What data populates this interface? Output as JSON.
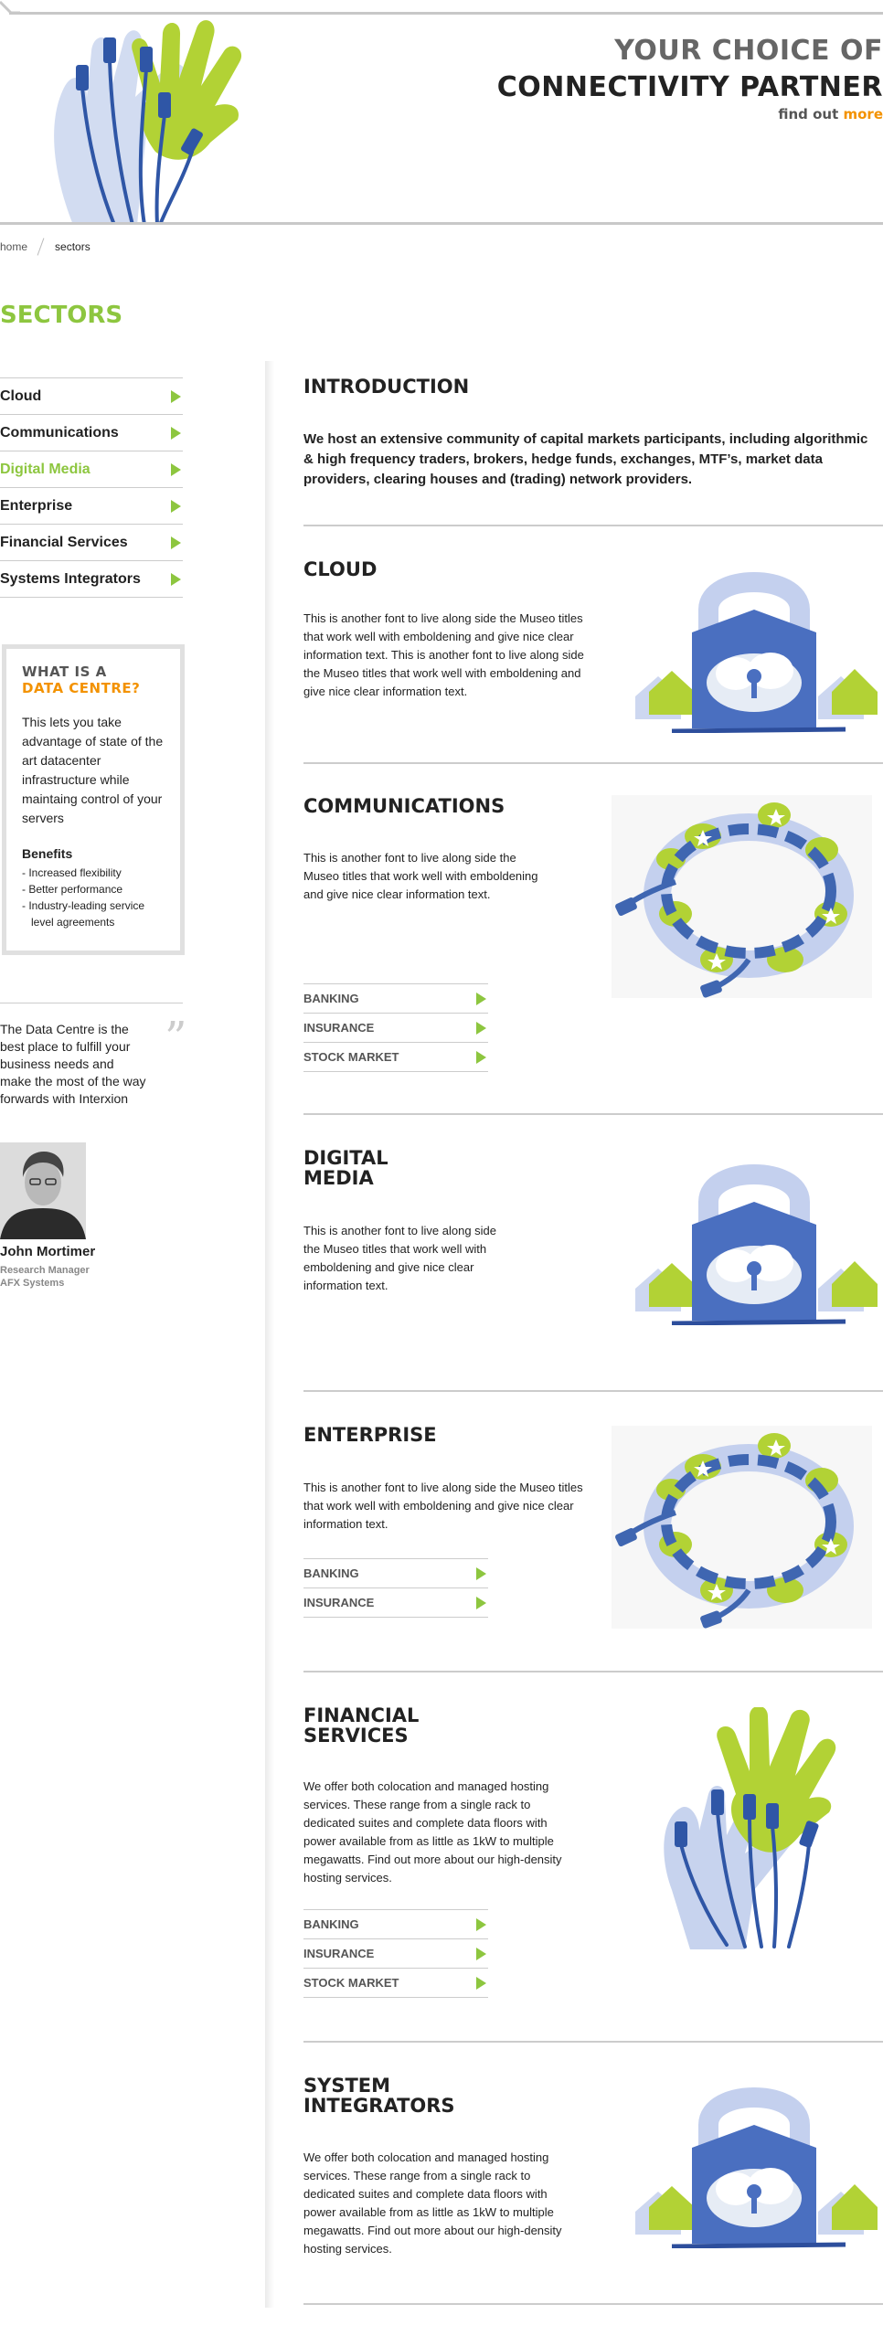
{
  "hero": {
    "title_line1": "YOUR CHOICE OF",
    "title_line2": "CONNECTIVITY PARTNER",
    "link_prefix": "find out ",
    "link_more": "more"
  },
  "breadcrumb": {
    "home": "home",
    "current": "sectors"
  },
  "page_title": "SECTORS",
  "sidebar": {
    "items": [
      {
        "label": "Cloud"
      },
      {
        "label": "Communications"
      },
      {
        "label": "Digital Media"
      },
      {
        "label": "Enterprise"
      },
      {
        "label": "Financial Services"
      },
      {
        "label": "Systems Integrators"
      }
    ],
    "active_index": 2
  },
  "data_centre_box": {
    "heading1": "WHAT IS A",
    "heading2": "DATA CENTRE?",
    "body": "This lets you take advantage of state of the art datacenter infrastructure while maintaing control of your servers",
    "benefits_title": "Benefits",
    "benefits": [
      "- Increased flexibility",
      "- Better performance",
      "- Industry-leading service level agreements"
    ]
  },
  "testimonial": {
    "quote": "The Data Centre is the best place to fulfill your business needs and make the most of the way forwards with Interxion",
    "quote_mark": "”",
    "name": "John Mortimer",
    "role": "Research Manager",
    "company": "AFX Systems"
  },
  "intro": {
    "title": "INTRODUCTION",
    "text": "We host an extensive community of capital markets participants, including algorithmic & high frequency traders, brokers, hedge funds, exchanges, MTF’s, market data providers, clearing houses and (trading) network providers."
  },
  "sections": [
    {
      "title": "CLOUD",
      "text": "This is another font to live along side the Museo titles that work well with emboldening and give nice clear information text.  This is another font to live along side the Museo titles that work well with emboldening and give nice clear information text.",
      "links": []
    },
    {
      "title": "COMMUNICATIONS",
      "text": "This is another font to live along side the Museo titles that work well with emboldening and give nice clear information text.",
      "links": [
        "BANKING",
        "INSURANCE",
        "STOCK MARKET"
      ]
    },
    {
      "title_line1": "DIGITAL",
      "title_line2": "MEDIA",
      "text": "This is another font to live along side the Museo titles that work well with emboldening and give nice clear information text.",
      "links": []
    },
    {
      "title": "ENTERPRISE",
      "text": "This is another font to live along side the Museo titles that work well with emboldening and give nice clear information text.",
      "links": [
        "BANKING",
        "INSURANCE"
      ]
    },
    {
      "title_line1": "FINANCIAL",
      "title_line2": "SERVICES",
      "text": "We offer both colocation and managed hosting services. These range from a single rack to dedicated suites and complete data floors with power available from as little as 1kW to multiple megawatts. Find out more about our high-density hosting services.",
      "links": [
        "BANKING",
        "INSURANCE",
        "STOCK MARKET"
      ]
    },
    {
      "title_line1": "SYSTEM",
      "title_line2": "INTEGRATORS",
      "text": "We offer both colocation and managed hosting services. These range from a single rack to dedicated suites and complete data floors with power available from as little as 1kW to multiple megawatts. Find out more about our high-density hosting services.",
      "links": []
    }
  ],
  "colors": {
    "accent_green": "#8dc63f",
    "accent_orange": "#f39200",
    "art_blue": "#3f66b1",
    "art_light_blue": "#aebfe6"
  }
}
